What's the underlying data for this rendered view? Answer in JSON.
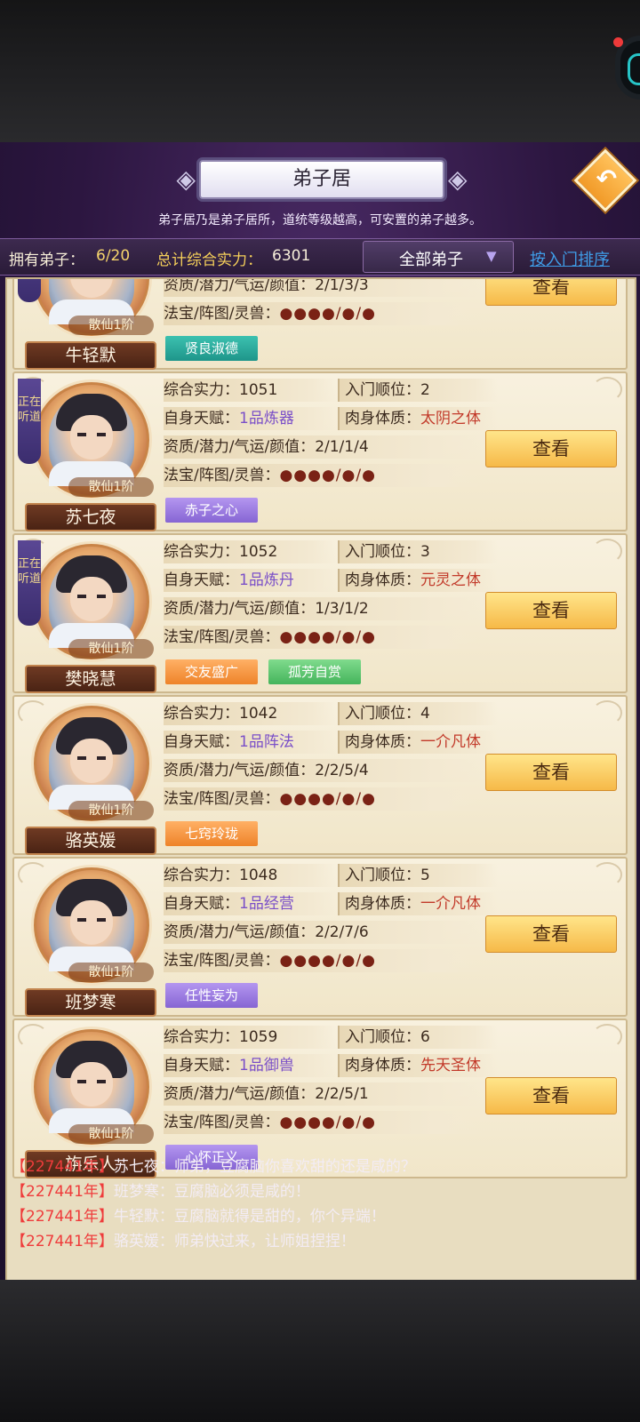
{
  "panel": {
    "title": "弟子居",
    "description": "弟子居乃是弟子居所，道统等级越高，可安置的弟子越多。",
    "back_icon": "↶"
  },
  "stats": {
    "count_label": "拥有弟子：",
    "count_value": "6/20",
    "power_label": "总计综合实力：",
    "power_value": "6301",
    "filter_selected": "全部弟子",
    "filter_caret": "▼",
    "sort_link": "按入门排序"
  },
  "labels": {
    "power": "综合实力：",
    "order": "入门顺位：",
    "talent": "自身天赋：",
    "body": "肉身体质：",
    "attributes": "资质/潜力/气运/颜值：",
    "gear": "法宝/阵图/灵兽：",
    "gear_dots": "●●●●/●/●",
    "view_button": "查看",
    "listening": "正在听道"
  },
  "disciples": [
    {
      "name": "牛轻默",
      "rank": "散仙1阶",
      "attributes": "2/1/3/3",
      "traits": [
        {
          "text": "贤良淑德",
          "color": "teal"
        }
      ],
      "listening": true
    },
    {
      "name": "苏七夜",
      "rank": "散仙1阶",
      "power": "1051",
      "order": "2",
      "talent": "1品炼器",
      "body": "太阴之体",
      "attributes": "2/1/1/4",
      "traits": [
        {
          "text": "赤子之心",
          "color": "purple"
        }
      ],
      "listening": true
    },
    {
      "name": "樊晓慧",
      "rank": "散仙1阶",
      "power": "1052",
      "order": "3",
      "talent": "1品炼丹",
      "body": "元灵之体",
      "attributes": "1/3/1/2",
      "traits": [
        {
          "text": "交友盛广",
          "color": "orange"
        },
        {
          "text": "孤芳自赏",
          "color": "green"
        }
      ],
      "listening": true
    },
    {
      "name": "骆英媛",
      "rank": "散仙1阶",
      "power": "1042",
      "order": "4",
      "talent": "1品阵法",
      "body": "一介凡体",
      "attributes": "2/2/5/4",
      "traits": [
        {
          "text": "七窍玲珑",
          "color": "orange"
        }
      ],
      "listening": false
    },
    {
      "name": "班梦寒",
      "rank": "散仙1阶",
      "power": "1048",
      "order": "5",
      "talent": "1品经营",
      "body": "一介凡体",
      "attributes": "2/2/7/6",
      "traits": [
        {
          "text": "任性妄为",
          "color": "purple"
        }
      ],
      "listening": false
    },
    {
      "name": "旃乐人",
      "rank": "散仙1阶",
      "power": "1059",
      "order": "6",
      "talent": "1品御兽",
      "body": "先天圣体",
      "attributes": "2/2/5/1",
      "traits": [
        {
          "text": "心怀正义",
          "color": "purple"
        }
      ],
      "listening": false
    }
  ],
  "chat": [
    {
      "year": "【227441年】",
      "speaker": "苏七夜：",
      "text": "师弟，豆腐脑你喜欢甜的还是咸的？"
    },
    {
      "year": "【227441年】",
      "speaker": "班梦寒：",
      "text": "豆腐脑必须是咸的！"
    },
    {
      "year": "【227441年】",
      "speaker": "牛轻默：",
      "text": "豆腐脑就得是甜的，你个异端！"
    },
    {
      "year": "【227441年】",
      "speaker": "骆英媛：",
      "text": "师弟快过来，让师姐捏捏！"
    }
  ]
}
